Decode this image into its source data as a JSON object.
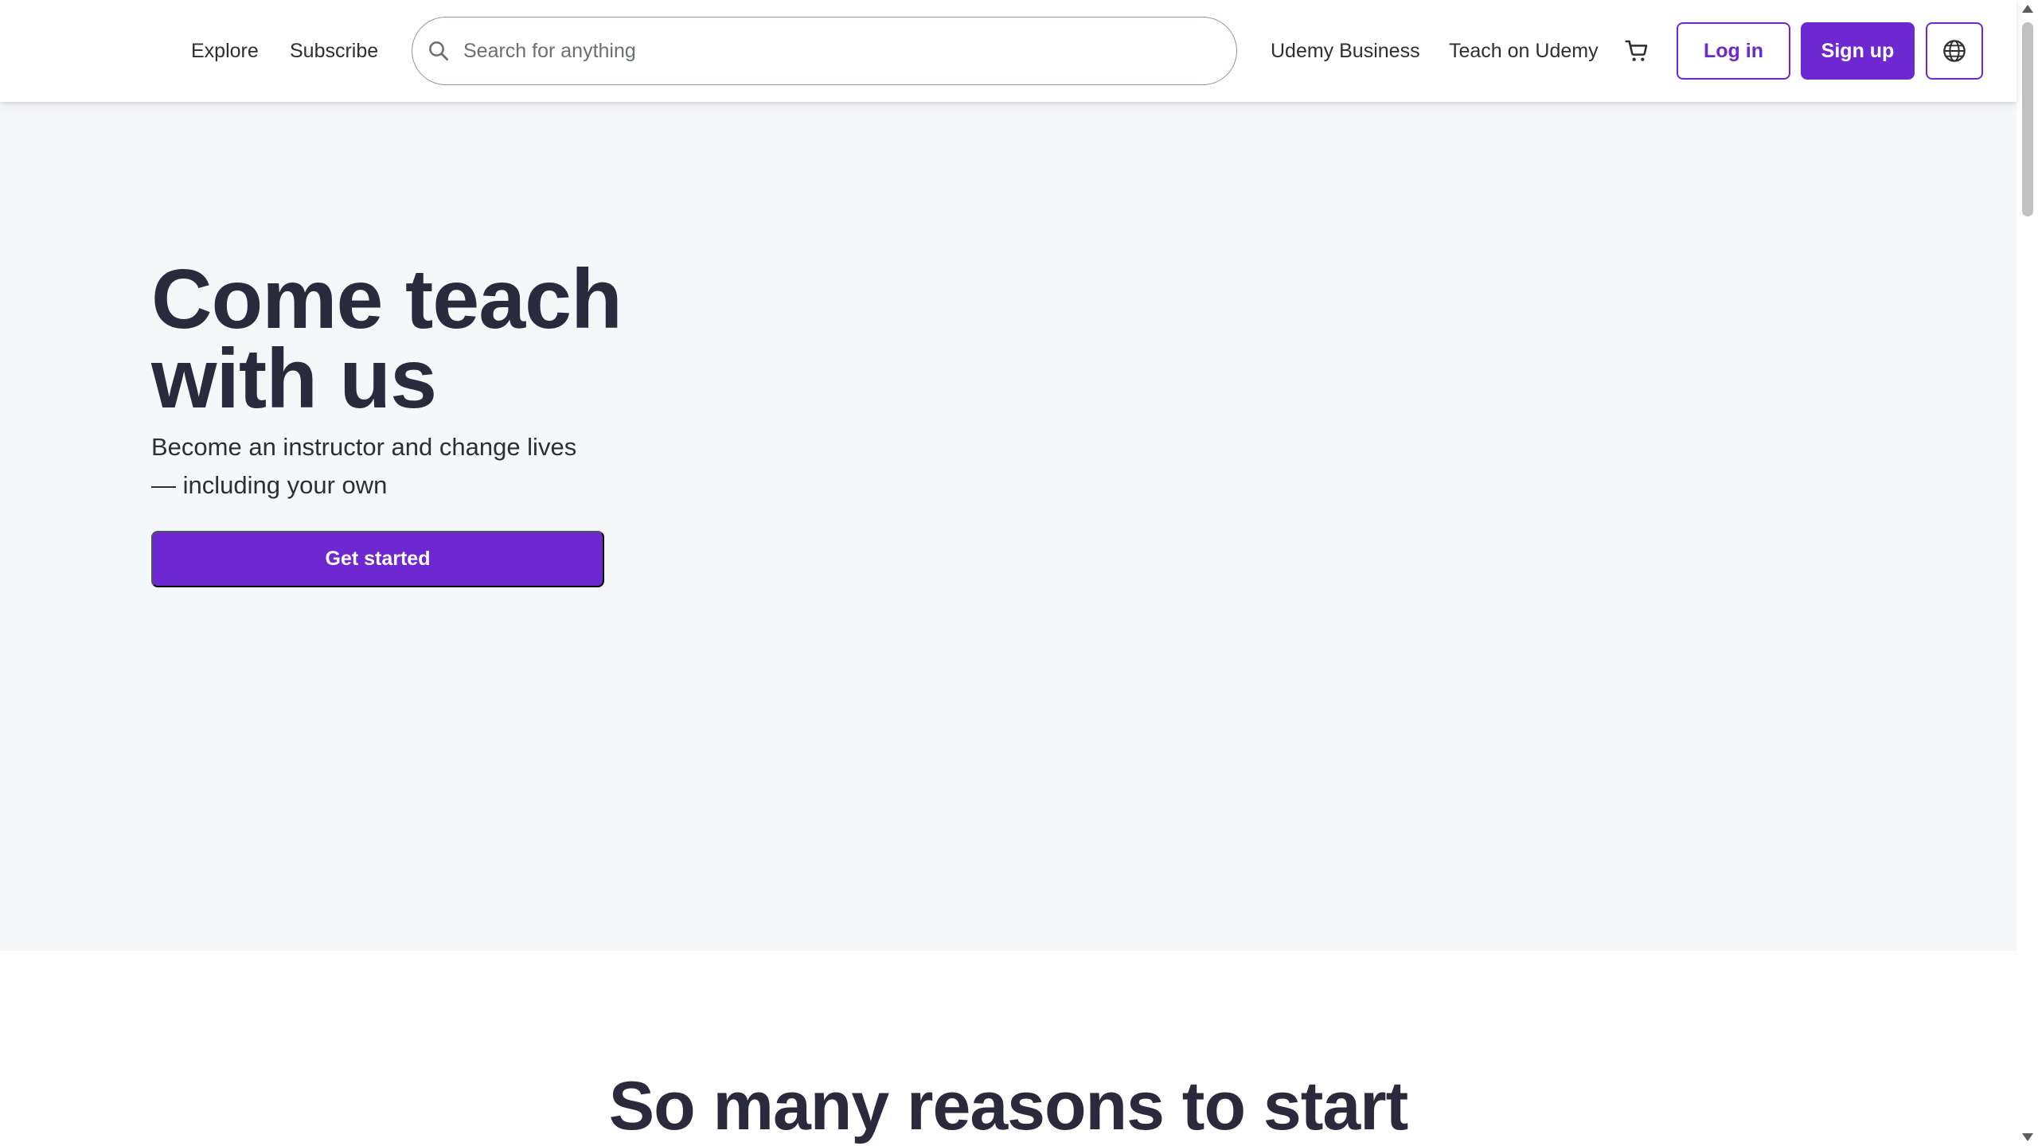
{
  "header": {
    "nav": {
      "explore": "Explore",
      "subscribe": "Subscribe",
      "business": "Udemy Business",
      "teach": "Teach on Udemy"
    },
    "search": {
      "placeholder": "Search for anything",
      "icon": "search-icon"
    },
    "cart_icon": "cart-icon",
    "login_label": "Log in",
    "signup_label": "Sign up",
    "language_icon": "globe-icon"
  },
  "hero": {
    "title": "Come teach with us",
    "subtitle": "Become an instructor and change lives — including your own",
    "cta_label": "Get started"
  },
  "section": {
    "heading": "So many reasons to start"
  },
  "colors": {
    "brand": "#6d28d2",
    "heading_text": "#2b2a3d",
    "body_text": "#2d2f31",
    "hero_background": "#f6f7f9"
  }
}
